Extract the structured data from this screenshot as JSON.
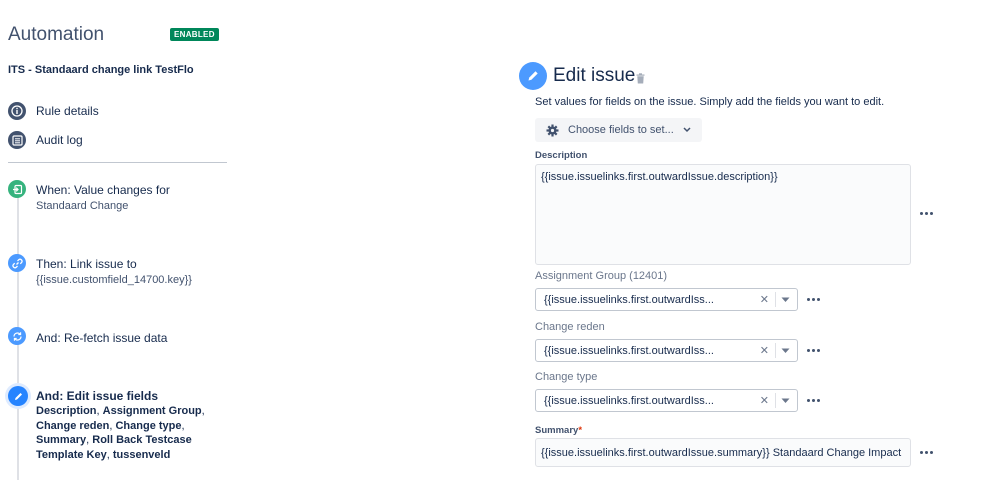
{
  "header": {
    "title": "Automation",
    "status_badge": "ENABLED",
    "rule_name": "ITS - Standaard change link TestFlo"
  },
  "nav": [
    {
      "label": "Rule details",
      "icon": "info-icon"
    },
    {
      "label": "Audit log",
      "icon": "list-icon"
    }
  ],
  "steps": {
    "trigger": {
      "title": "When: Value changes for",
      "detail": "Standaard Change",
      "icon": "trigger-icon",
      "color": "#36b37e"
    },
    "link": {
      "title": "Then: Link issue to",
      "detail": "{{issue.customfield_14700.key}}",
      "icon": "link-icon",
      "color": "#4c9aff"
    },
    "refetch": {
      "title": "And: Re-fetch issue data",
      "icon": "refresh-icon",
      "color": "#4c9aff"
    },
    "edit": {
      "title": "And: Edit issue fields",
      "fields": [
        "Description",
        "Assignment Group",
        "Change reden",
        "Change type",
        "Summary",
        "Roll Back Testcase Template Key",
        "tussenveld"
      ],
      "icon": "pencil-icon",
      "color": "#2684ff"
    }
  },
  "editor": {
    "title": "Edit issue",
    "subtitle": "Set values for fields on the issue. Simply add the fields you want to edit.",
    "choose_button": "Choose fields to set...",
    "description": {
      "label": "Description",
      "value": "{{issue.issuelinks.first.outwardIssue.description}}"
    },
    "assignment_group": {
      "label": "Assignment Group (12401)",
      "value": "{{issue.issuelinks.first.outwardIss..."
    },
    "change_reden": {
      "label": "Change reden",
      "value": "{{issue.issuelinks.first.outwardIss..."
    },
    "change_type": {
      "label": "Change type",
      "value": "{{issue.issuelinks.first.outwardIss..."
    },
    "summary": {
      "label": "Summary",
      "required_mark": "*",
      "value": "{{issue.issuelinks.first.outwardIssue.summary}} Standaard Change Impact"
    }
  }
}
